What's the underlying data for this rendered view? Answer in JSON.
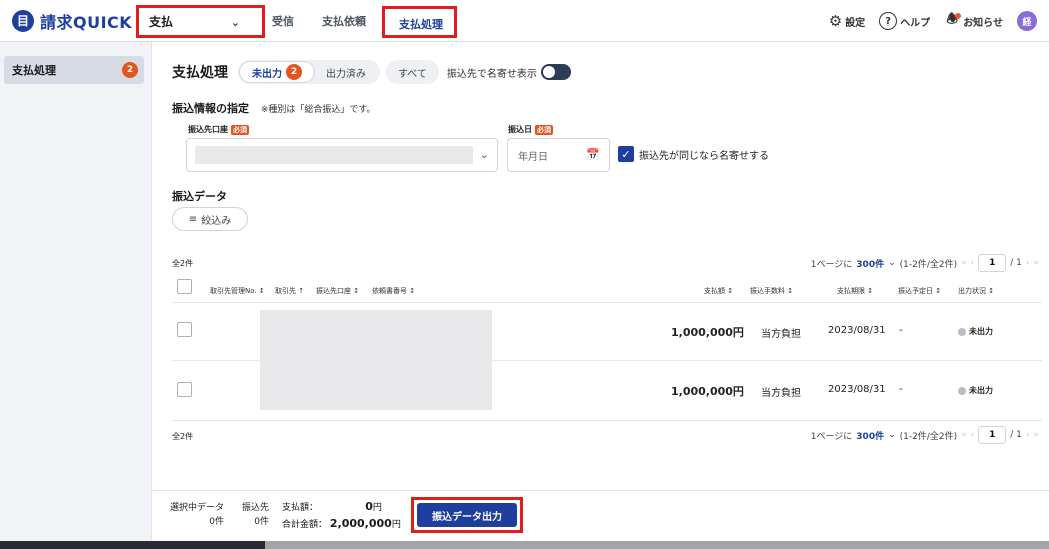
{
  "header": {
    "logo_text": "請求QUICK",
    "logo_mark": "目",
    "module_select": "支払",
    "nav": [
      "受信",
      "支払依頼",
      "支払処理"
    ],
    "settings": "設定",
    "help": "ヘルプ",
    "notifications": "お知らせ",
    "avatar_initial": "経"
  },
  "sidebar": {
    "items": [
      {
        "label": "支払処理",
        "badge": "2"
      }
    ]
  },
  "main": {
    "title": "支払処理",
    "tabs": [
      {
        "label": "未出力",
        "badge": "2"
      },
      {
        "label": "出力済み"
      }
    ],
    "tab_all": "すべて",
    "toggle_label": "振込先で名寄せ表示",
    "transfer_section": {
      "title": "振込情報の指定",
      "note": "※種別は「総合振込」です。",
      "account_label": "振込先口座",
      "date_label": "振込日",
      "required_tag": "必須",
      "date_placeholder": "年月日",
      "merge_label": "振込先が同じなら名寄せする"
    },
    "data_section": {
      "title": "振込データ",
      "filter_label": "絞込み"
    },
    "table": {
      "total_count": "全2件",
      "pager": {
        "prefix": "1ページに",
        "per_page": "300件",
        "range": "(1-2件/全2件)",
        "current": "1",
        "total_pages": "/ 1"
      },
      "columns": [
        "取引先管理No.",
        "取引先",
        "振込先口座",
        "依頼書番号",
        "支払額",
        "振込手数料",
        "支払期限",
        "振込予定日",
        "出力状況"
      ],
      "rows": [
        {
          "amount": "1,000,000円",
          "fee": "当方負担",
          "due": "2023/08/31",
          "scheduled": "-",
          "status": "未出力"
        },
        {
          "amount": "1,000,000円",
          "fee": "当方負担",
          "due": "2023/08/31",
          "scheduled": "-",
          "status": "未出力"
        }
      ]
    }
  },
  "footer": {
    "selected_label": "選択中データ",
    "selected_count": "0件",
    "payee_label": "振込先",
    "payee_count": "0件",
    "amount_label": "支払額：",
    "amount_value": "0",
    "amount_unit": "円",
    "total_label": "合計金額：",
    "total_value": "2,000,000",
    "total_unit": "円",
    "export_label": "振込データ出力"
  },
  "colors": {
    "brand": "#1f3f9f",
    "highlight": "#e21b1b",
    "badge": "#e2551f"
  }
}
